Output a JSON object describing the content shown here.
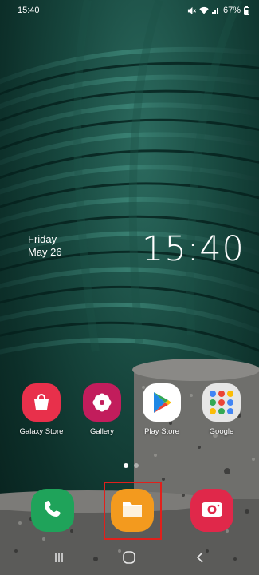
{
  "status_bar": {
    "time": "15:40",
    "battery": "67%",
    "icons": [
      "mute-icon",
      "wifi-icon",
      "signal-icon",
      "battery-icon"
    ]
  },
  "lockscreen": {
    "day": "Friday",
    "date": "May 26",
    "clock": "15:40"
  },
  "apps": [
    {
      "label": "Galaxy Store",
      "icon": "galaxy-store-bag-icon",
      "color": "#e8304b"
    },
    {
      "label": "Gallery",
      "icon": "gallery-flower-icon",
      "color": "#c21d5c"
    },
    {
      "label": "Play Store",
      "icon": "play-store-triangle-icon",
      "color": "#ffffff"
    },
    {
      "label": "Google",
      "icon": "google-folder-icon",
      "color": "#e6e6e6"
    }
  ],
  "page_indicator": {
    "count": 2,
    "active": 0
  },
  "dock": [
    {
      "name": "Phone",
      "icon": "phone-icon",
      "color": "#1fa35a"
    },
    {
      "name": "My Files",
      "icon": "folder-icon",
      "color": "#f39a1e"
    },
    {
      "name": "Camera",
      "icon": "camera-icon",
      "color": "#e0284a"
    }
  ],
  "navigation": [
    "recents-icon",
    "home-icon",
    "back-icon"
  ],
  "accent_highlight": "#e0201c"
}
